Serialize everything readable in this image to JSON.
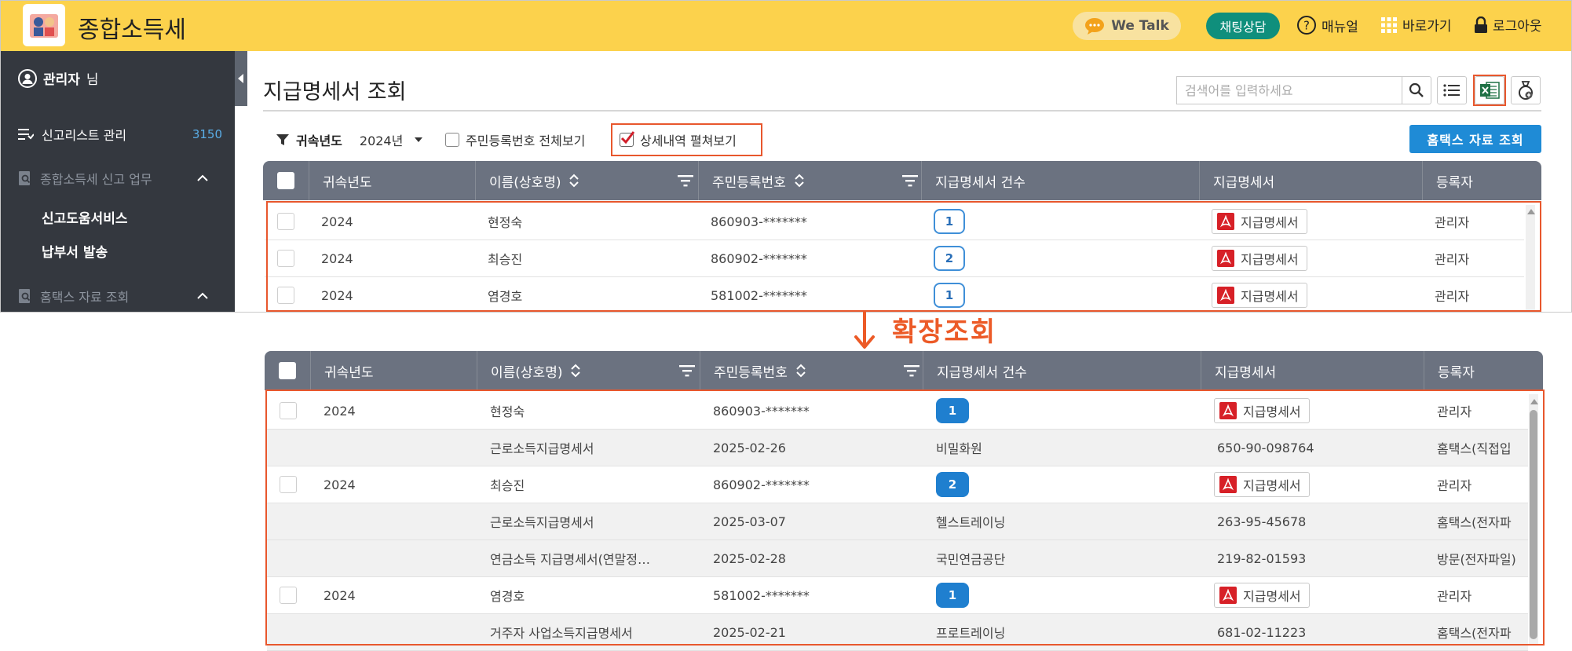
{
  "app": {
    "title": "종합소득세",
    "we_talk": "We Talk",
    "chat_consult": "채팅상담",
    "manual": "매뉴얼",
    "shortcut": "바로가기",
    "logout": "로그아웃"
  },
  "sidebar": {
    "user_name": "관리자",
    "user_suffix": "님",
    "items": [
      {
        "label": "신고리스트 관리",
        "count": "3150"
      },
      {
        "label": "종합소득세 신고 업무"
      },
      {
        "label": "신고도움서비스"
      },
      {
        "label": "납부서 발송"
      },
      {
        "label": "홈택스 자료 조회"
      }
    ]
  },
  "main": {
    "page_title": "지급명세서 조회",
    "search_placeholder": "검색어를 입력하세요",
    "filter": {
      "year_label": "귀속년도",
      "year_value": "2024년",
      "show_full_rrn": "주민등록번호 전체보기",
      "expand_details": "상세내역 펼쳐보기"
    },
    "hometax_button": "홈택스 자료 조회"
  },
  "table": {
    "columns": [
      "귀속년도",
      "이름(상호명)",
      "주민등록번호",
      "지급명세서 건수",
      "지급명세서",
      "등록자"
    ],
    "pdf_label": "지급명세서",
    "rows_collapsed": [
      {
        "year": "2024",
        "name": "현정숙",
        "rrn": "860903-*******",
        "count": "1",
        "registrant": "관리자"
      },
      {
        "year": "2024",
        "name": "최승진",
        "rrn": "860902-*******",
        "count": "2",
        "registrant": "관리자"
      },
      {
        "year": "2024",
        "name": "염경호",
        "rrn": "581002-*******",
        "count": "1",
        "registrant": "관리자"
      }
    ],
    "rows_expanded": [
      {
        "kind": "main",
        "year": "2024",
        "name": "현정숙",
        "rrn": "860903-*******",
        "count": "1",
        "registrant": "관리자"
      },
      {
        "kind": "sub",
        "name": "근로소득지급명세서",
        "date": "2025-02-26",
        "payer": "비밀화원",
        "biz_no": "650-90-098764",
        "source": "홈택스(직접입"
      },
      {
        "kind": "main",
        "year": "2024",
        "name": "최승진",
        "rrn": "860902-*******",
        "count": "2",
        "registrant": "관리자"
      },
      {
        "kind": "sub",
        "name": "근로소득지급명세서",
        "date": "2025-03-07",
        "payer": "헬스트레이닝",
        "biz_no": "263-95-45678",
        "source": "홈택스(전자파"
      },
      {
        "kind": "sub",
        "name": "연금소득 지급명세서(연말정…",
        "date": "2025-02-28",
        "payer": "국민연금공단",
        "biz_no": "219-82-01593",
        "source": "방문(전자파일)"
      },
      {
        "kind": "main",
        "year": "2024",
        "name": "염경호",
        "rrn": "581002-*******",
        "count": "1",
        "registrant": "관리자"
      },
      {
        "kind": "sub",
        "name": "거주자 사업소득지급명세서",
        "date": "2025-02-21",
        "payer": "프로트레이닝",
        "biz_no": "681-02-11223",
        "source": "홈택스(전자파"
      }
    ]
  },
  "annotation": {
    "label": "확장조회",
    "color": "#ec5a27"
  }
}
